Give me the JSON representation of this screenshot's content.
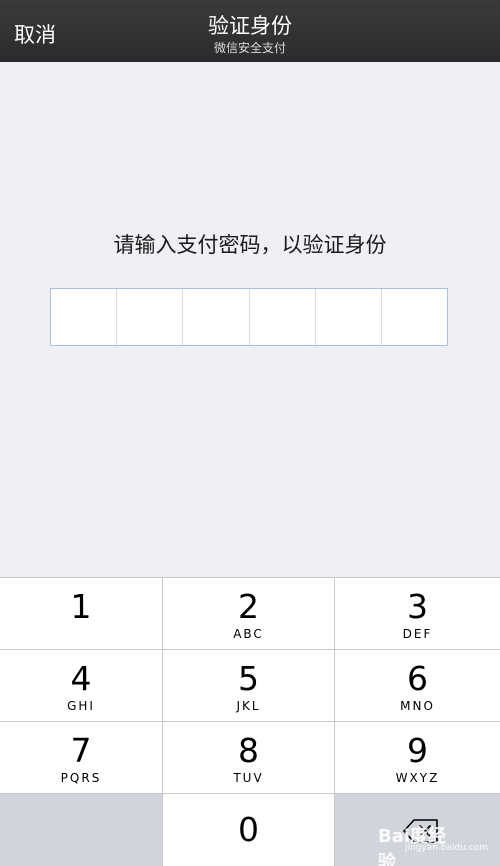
{
  "navbar": {
    "cancel_label": "取消",
    "title": "验证身份",
    "subtitle": "微信安全支付"
  },
  "prompt": {
    "text": "请输入支付密码，以验证身份"
  },
  "pin": {
    "length": 6,
    "entered": ""
  },
  "keypad": {
    "keys": [
      {
        "num": "1",
        "letters": ""
      },
      {
        "num": "2",
        "letters": "ABC"
      },
      {
        "num": "3",
        "letters": "DEF"
      },
      {
        "num": "4",
        "letters": "GHI"
      },
      {
        "num": "5",
        "letters": "JKL"
      },
      {
        "num": "6",
        "letters": "MNO"
      },
      {
        "num": "7",
        "letters": "PQRS"
      },
      {
        "num": "8",
        "letters": "TUV"
      },
      {
        "num": "9",
        "letters": "WXYZ"
      },
      {
        "num": "0",
        "letters": ""
      }
    ],
    "delete_icon": "backspace-icon"
  },
  "watermark": {
    "main": "Bai度经验",
    "sub": "jingyan.baidu.com"
  },
  "colors": {
    "navbar_bg": "#2b2b2d",
    "page_bg": "#efeff4",
    "pin_border": "#a9bfe2",
    "keypad_bg": "#d1d5db"
  }
}
